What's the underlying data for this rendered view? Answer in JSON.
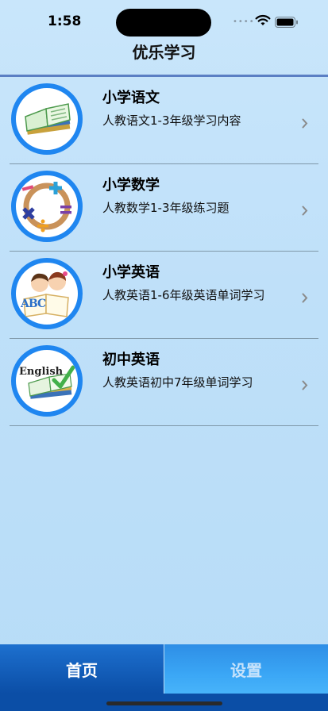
{
  "status": {
    "time": "1:58",
    "dots": "••••"
  },
  "nav": {
    "title": "优乐学习"
  },
  "list": [
    {
      "title": "小学语文",
      "subtitle": "人教语文1-3年级学习内容"
    },
    {
      "title": "小学数学",
      "subtitle": "人教数学1-3年级练习题"
    },
    {
      "title": "小学英语",
      "subtitle": "人教英语1-6年级英语单词学习"
    },
    {
      "title": "初中英语",
      "subtitle": "人教英语初中7年级单词学习"
    }
  ],
  "icon_texts": {
    "abc": "ABC",
    "english": "English"
  },
  "tabs": {
    "home": "首页",
    "settings": "设置"
  },
  "colors": {
    "accent": "#1f86f0",
    "tab_active": "#0b4ea6",
    "tab_inactive": "#3aa6f5"
  }
}
